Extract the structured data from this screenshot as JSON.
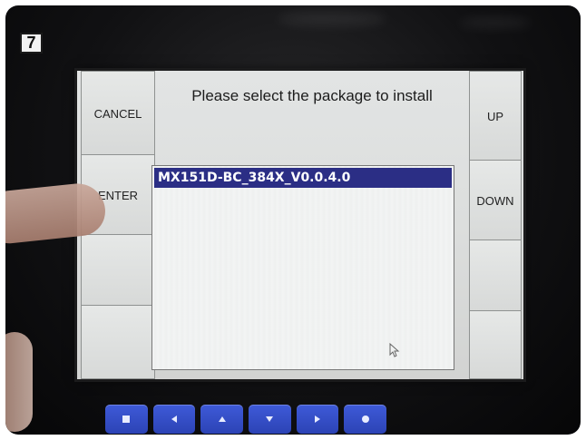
{
  "step_number": "7",
  "screen": {
    "title": "Please select the package to install",
    "left_softkeys": [
      {
        "label": "CANCEL"
      },
      {
        "label": "ENTER"
      },
      {
        "label": ""
      },
      {
        "label": ""
      }
    ],
    "right_softkeys": [
      {
        "label": "UP"
      },
      {
        "label": "DOWN"
      },
      {
        "label": ""
      },
      {
        "label": ""
      }
    ],
    "package_list": {
      "items": [
        {
          "label": "MX151D-BC_384X_V0.0.4.0",
          "selected": true
        }
      ],
      "selected_color": "#2b2e85"
    }
  },
  "hardware_buttons": [
    {
      "icon": "square-icon"
    },
    {
      "icon": "arrow-left-icon"
    },
    {
      "icon": "arrow-up-icon"
    },
    {
      "icon": "arrow-down-icon"
    },
    {
      "icon": "arrow-right-icon"
    },
    {
      "icon": "circle-icon"
    }
  ],
  "colors": {
    "bezel": "#111113",
    "hardware_button_blue": "#3350c9",
    "screen_background": "#dcdedd"
  }
}
